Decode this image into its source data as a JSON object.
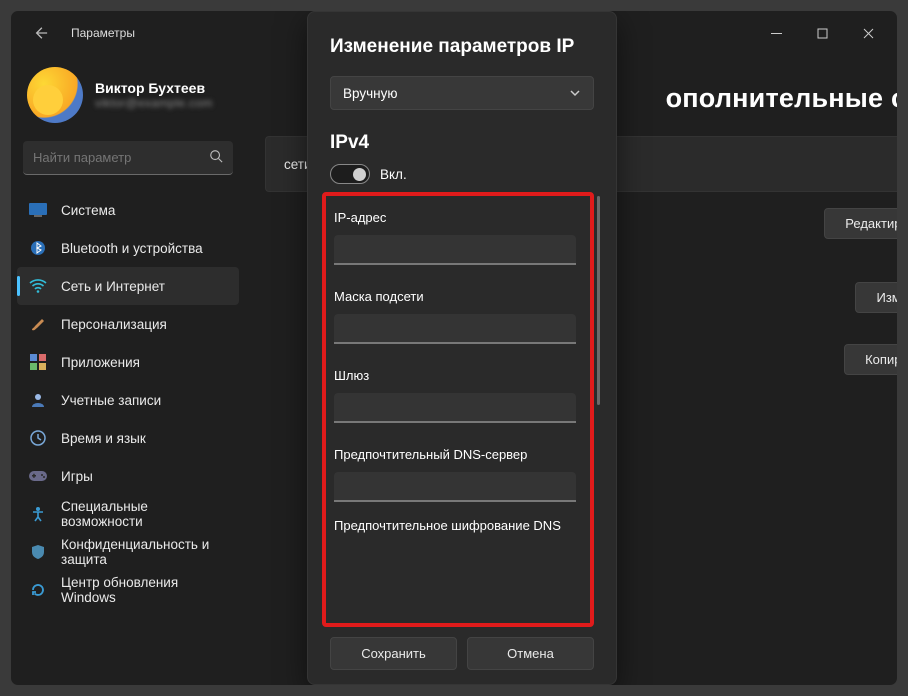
{
  "titlebar": {
    "app_title": "Параметры"
  },
  "profile": {
    "name": "Виктор Бухтеев",
    "email_masked": "viktor@example.com"
  },
  "search": {
    "placeholder": "Найти параметр"
  },
  "sidebar": {
    "items": [
      {
        "label": "Система"
      },
      {
        "label": "Bluetooth и устройства"
      },
      {
        "label": "Сеть и Интернет"
      },
      {
        "label": "Персонализация"
      },
      {
        "label": "Приложения"
      },
      {
        "label": "Учетные записи"
      },
      {
        "label": "Время и язык"
      },
      {
        "label": "Игры"
      },
      {
        "label": "Специальные возможности"
      },
      {
        "label": "Конфиденциальность и защита"
      },
      {
        "label": "Центр обновления Windows"
      }
    ]
  },
  "main": {
    "title_suffix": "ополнительные свой",
    "card0": "сети",
    "btn_edit": "Редактировать",
    "btn_change": "Изменить",
    "btn_copy": "Копировать"
  },
  "dialog": {
    "title": "Изменение параметров IP",
    "mode": "Вручную",
    "section": "IPv4",
    "toggle_label": "Вкл.",
    "fields": {
      "ip_label": "IP-адрес",
      "mask_label": "Маска подсети",
      "gateway_label": "Шлюз",
      "dns_label": "Предпочтительный DNS-сервер",
      "dns_enc_label": "Предпочтительное шифрование DNS"
    },
    "save": "Сохранить",
    "cancel": "Отмена"
  }
}
